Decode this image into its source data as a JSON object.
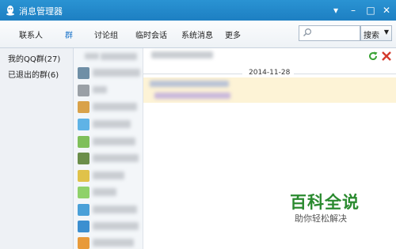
{
  "window": {
    "title": "消息管理器"
  },
  "tabs": [
    {
      "label": "联系人"
    },
    {
      "label": "群",
      "active": true
    },
    {
      "label": "讨论组"
    },
    {
      "label": "临时会话"
    },
    {
      "label": "系统消息"
    },
    {
      "label": "更多"
    }
  ],
  "search": {
    "placeholder": "",
    "button_label": "搜索"
  },
  "left_panel": {
    "items": [
      {
        "label": "我的QQ群(27)"
      },
      {
        "label": "已退出的群(6)"
      }
    ]
  },
  "messages": {
    "date": "2014-11-28"
  },
  "watermark": {
    "title": "百科全说",
    "subtitle": "助你轻松解决"
  },
  "colors": {
    "title_bar": "#1d7fc2",
    "active_tab": "#1a73c9",
    "highlight_row": "#fdf3d6",
    "restore_icon": "#3aa335",
    "delete_icon": "#d43a2c"
  }
}
